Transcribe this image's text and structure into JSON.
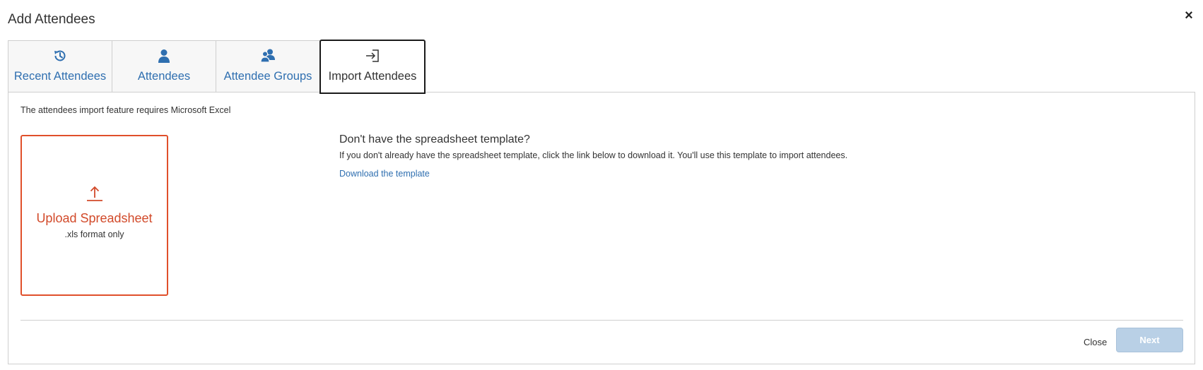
{
  "dialog": {
    "title": "Add Attendees",
    "close_glyph": "×"
  },
  "tabs": [
    {
      "label": "Recent Attendees",
      "icon": "history-icon",
      "active": false
    },
    {
      "label": "Attendees",
      "icon": "person-icon",
      "active": false
    },
    {
      "label": "Attendee Groups",
      "icon": "group-icon",
      "active": false
    },
    {
      "label": "Import Attendees",
      "icon": "import-icon",
      "active": true
    }
  ],
  "import": {
    "notice": "The attendees import feature requires Microsoft Excel",
    "upload": {
      "title": "Upload Spreadsheet",
      "subtitle": ".xls format only",
      "icon": "upload-icon"
    },
    "template": {
      "heading": "Don't have the spreadsheet template?",
      "description": "If you don't already have the spreadsheet template, click the link below to download it. You'll use this template to import attendees.",
      "link": "Download the template"
    }
  },
  "footer": {
    "close_label": "Close",
    "next_label": "Next"
  },
  "colors": {
    "accent_blue": "#2f6fb0",
    "upload_red": "#e0502b",
    "next_disabled": "#b9d0e6"
  }
}
